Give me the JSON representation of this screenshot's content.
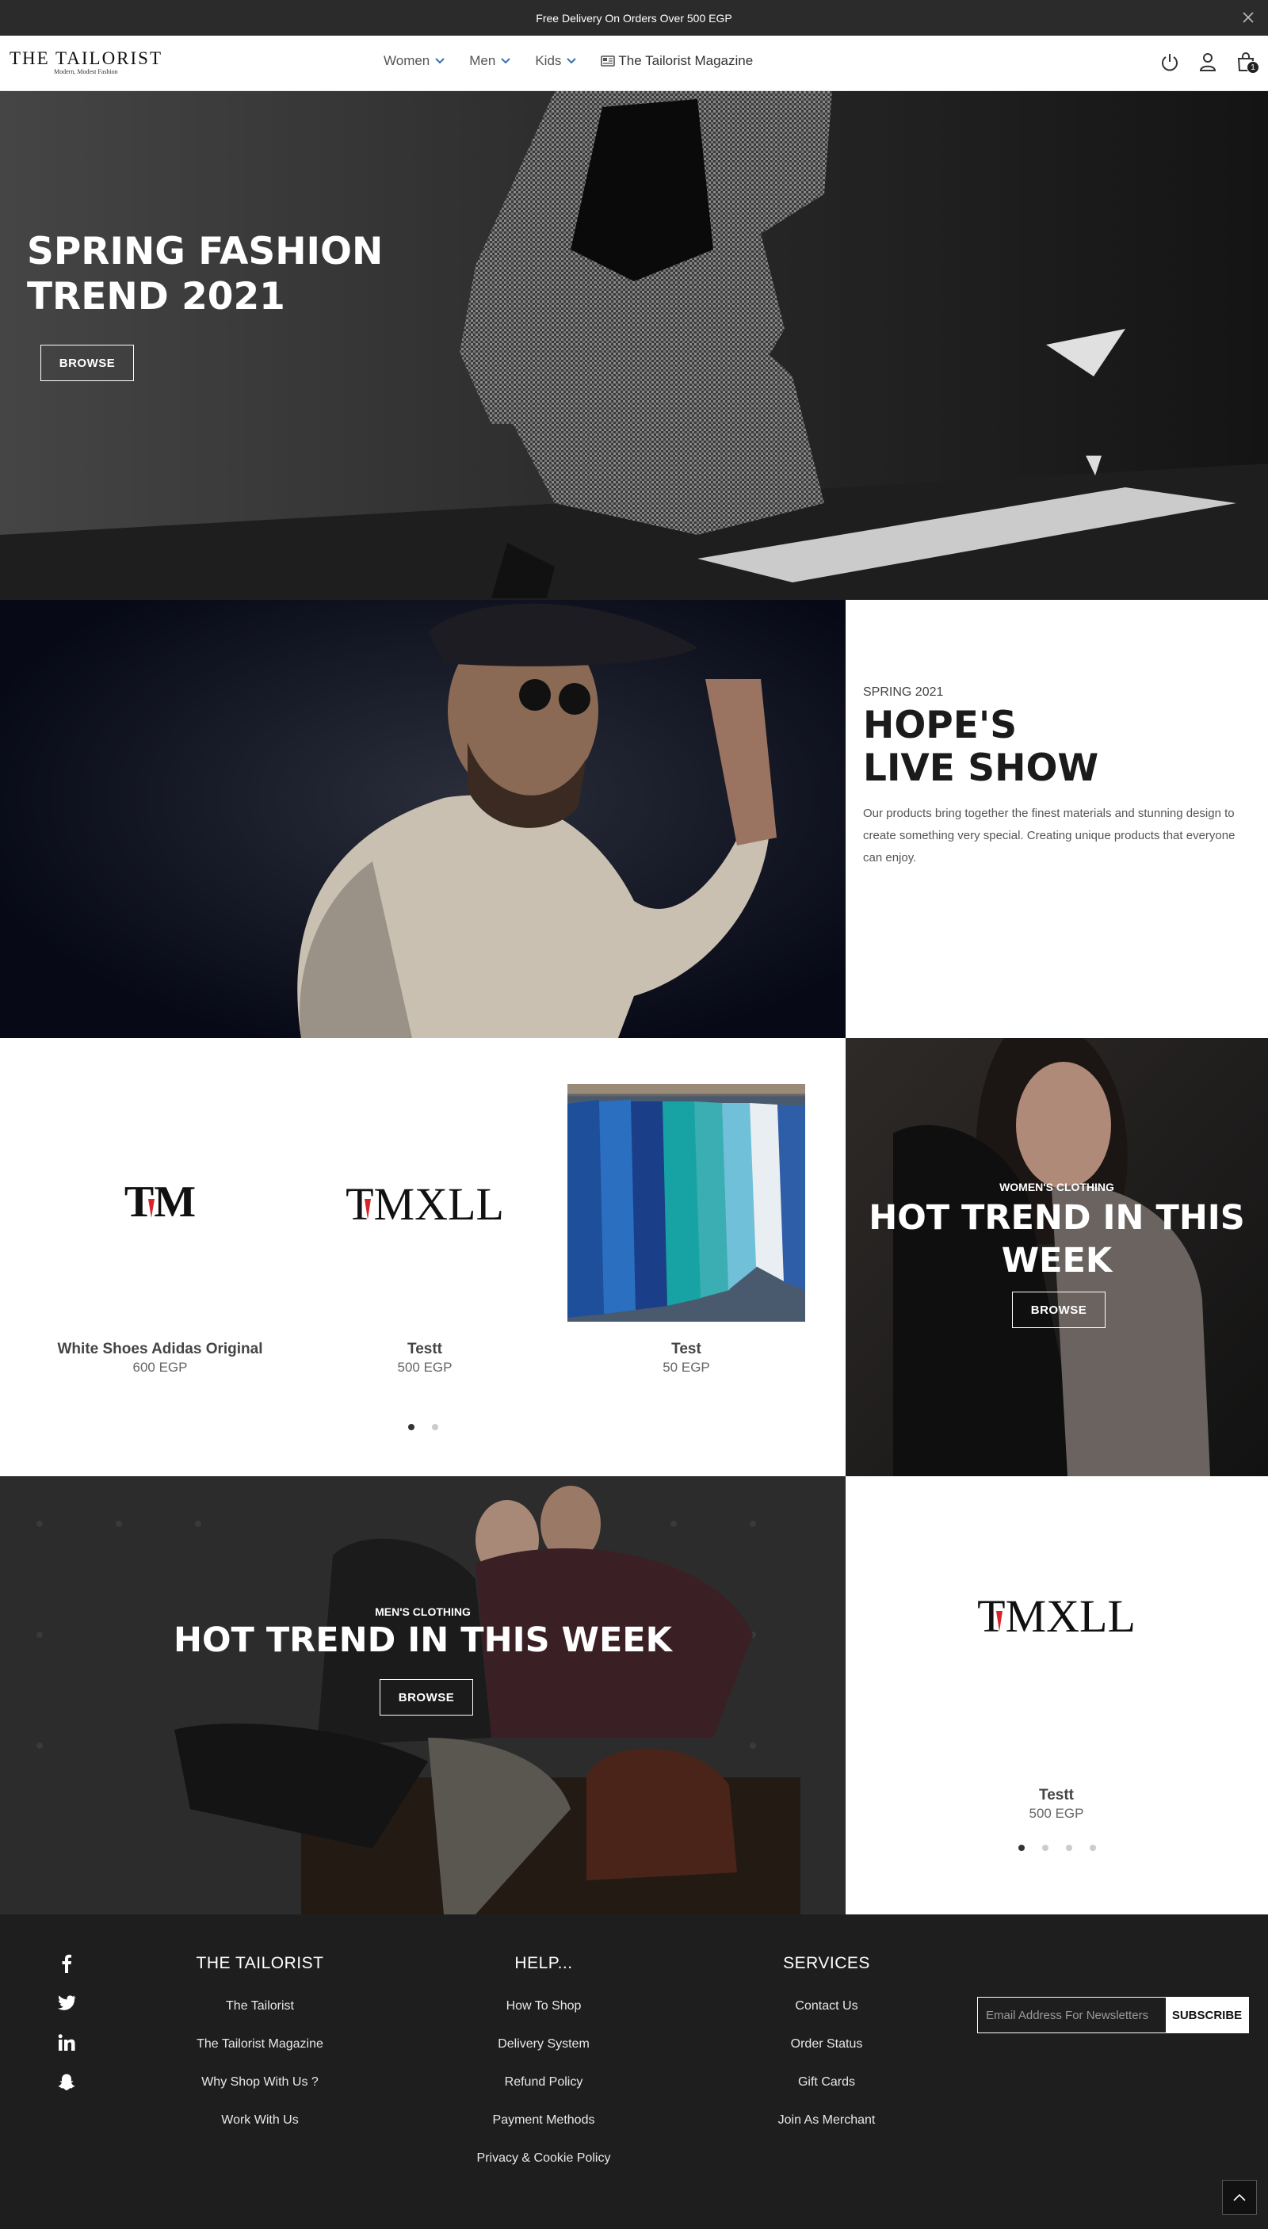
{
  "topbar": {
    "message": "Free Delivery On Orders Over 500 EGP",
    "close_icon": "close-icon"
  },
  "header": {
    "logo_main": "THE TAILORIST",
    "logo_tagline": "Modern, Modest Fashion",
    "menu": [
      {
        "label": "Women",
        "has_dropdown": true
      },
      {
        "label": "Men",
        "has_dropdown": true
      },
      {
        "label": "Kids",
        "has_dropdown": true
      },
      {
        "label": "The Tailorist Magazine",
        "icon": "magazine-icon"
      }
    ],
    "icons": [
      "power-icon",
      "user-icon",
      "bag-icon"
    ],
    "cart_count": "1"
  },
  "hero": {
    "title_line1": "SPRING FASHION",
    "title_line2": "TREND 2021",
    "button": "BROWSE"
  },
  "hopes": {
    "kicker": "SPRING 2021",
    "title_line1": "HOPE'S",
    "title_line2": "LIVE SHOW",
    "description": "Our products bring together the finest materials and stunning design to create something very special. Creating unique products that everyone can enjoy."
  },
  "products": [
    {
      "name": "White Shoes Adidas Original",
      "price": "600 EGP",
      "logo_text": "TM"
    },
    {
      "name": "Testt",
      "price": "500 EGP",
      "logo_text": "TMXLL"
    },
    {
      "name": "Test",
      "price": "50 EGP"
    }
  ],
  "products_dots": {
    "count": 2,
    "active": 0
  },
  "women_promo": {
    "kicker": "WOMEN'S CLOTHING",
    "title_line1": "HOT TREND IN THIS",
    "title_line2": "WEEK",
    "button": "BROWSE"
  },
  "men_promo": {
    "kicker": "MEN'S CLOTHING",
    "title": "HOT TREND IN THIS WEEK",
    "button": "BROWSE"
  },
  "featured": {
    "name": "Testt",
    "price": "500 EGP",
    "logo_text": "TMXLL",
    "dots": 4,
    "active": 0
  },
  "footer": {
    "social": [
      "facebook-icon",
      "twitter-icon",
      "linkedin-icon",
      "snapchat-icon"
    ],
    "columns": [
      {
        "title": "THE TAILORIST",
        "links": [
          "The Tailorist",
          "The Tailorist Magazine",
          "Why Shop With Us ?",
          "Work With Us"
        ]
      },
      {
        "title": "HELP...",
        "links": [
          "How To Shop",
          "Delivery System",
          "Refund Policy",
          "Payment Methods",
          "Privacy & Cookie Policy"
        ]
      },
      {
        "title": "SERVICES",
        "links": [
          "Contact Us",
          "Order Status",
          "Gift Cards",
          "Join As Merchant"
        ]
      }
    ],
    "newsletter_placeholder": "Email Address For Newsletters",
    "subscribe": "SUBSCRIBE"
  },
  "colors": {
    "topbar": "#2b2b2b",
    "footer": "#1e1e1e",
    "accent_chevron": "#3a6fb0",
    "logo_red": "#d8232a"
  }
}
